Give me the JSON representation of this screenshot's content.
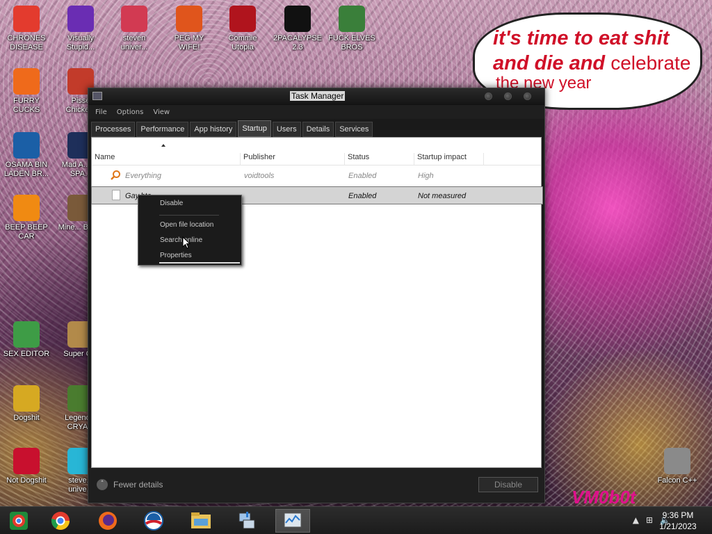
{
  "desktop": {
    "speech_bubble": {
      "line1": "it's time to eat shit",
      "line2_bold": "and die and",
      "line2_rest": "celebrate",
      "line3": "the new year"
    },
    "watermark": "VM0b0t",
    "icons": [
      {
        "label": "CHRONES DISEASE",
        "icon": "chrome-icon",
        "color": "#e33b2e"
      },
      {
        "label": "Visually Stupid...",
        "icon": "visual-studio-icon",
        "color": "#6a2db3"
      },
      {
        "label": "steven univer...",
        "icon": "steven-universe-icon",
        "color": "#d23a52"
      },
      {
        "label": "PEG MY WIFE!",
        "icon": "pizza-icon",
        "color": "#e0551c"
      },
      {
        "label": "Commie Utopia",
        "icon": "commie-icon",
        "color": "#b0141d"
      },
      {
        "label": "2PACALYPSE 2.3",
        "icon": "terminal-icon",
        "color": "#111111"
      },
      {
        "label": "FUCK ELVES BROS",
        "icon": "elf-icon",
        "color": "#3a7f3a"
      },
      {
        "label": "FURRY CUCKS",
        "icon": "firefox-icon",
        "color": "#ef6a1b"
      },
      {
        "label": "Pisse Chicke...",
        "icon": "angry-birds-icon",
        "color": "#c23b2a"
      },
      {
        "label": "OSAMA BIN LADEN BR...",
        "icon": "obama-icon",
        "color": "#1b5fa6"
      },
      {
        "label": "Mad A... IN SPA...",
        "icon": "angry-birds-space-icon",
        "color": "#1e2f5a"
      },
      {
        "label": "BEEP BEEP CAR",
        "icon": "vlc-icon",
        "color": "#f08a12"
      },
      {
        "label": "Mine... Bird...",
        "icon": "minecraft-bird-icon",
        "color": "#7a5a3a"
      },
      {
        "label": "SEX EDITOR",
        "icon": "hxd-icon",
        "color": "#3e9c46"
      },
      {
        "label": "Super C...",
        "icon": "super-c-icon",
        "color": "#b28a4a"
      },
      {
        "label": "Dogshit",
        "icon": "dog-icon",
        "color": "#d6a922"
      },
      {
        "label": "Legend... CRYA...",
        "icon": "legend-icon",
        "color": "#4a7c2f"
      },
      {
        "label": "Not Dogshit",
        "icon": "devcpp-icon",
        "color": "#c8102e"
      },
      {
        "label": "steve... unive...",
        "icon": "diamond-icon",
        "color": "#28b6d6"
      },
      {
        "label": "Falcon C++",
        "icon": "recycle-bin-icon",
        "color": "#8a8a8a"
      }
    ]
  },
  "task_manager": {
    "title": "Task Manager",
    "menu": [
      "File",
      "Options",
      "View"
    ],
    "tabs": [
      {
        "label": "Processes",
        "active": false
      },
      {
        "label": "Performance",
        "active": false
      },
      {
        "label": "App history",
        "active": false
      },
      {
        "label": "Startup",
        "active": true
      },
      {
        "label": "Users",
        "active": false
      },
      {
        "label": "Details",
        "active": false
      },
      {
        "label": "Services",
        "active": false
      }
    ],
    "columns": [
      "Name",
      "Publisher",
      "Status",
      "Startup impact"
    ],
    "rows": [
      {
        "name": "Everything",
        "publisher": "voidtools",
        "status": "Enabled",
        "impact": "High",
        "icon": "search-magnifier-icon",
        "selected": false
      },
      {
        "name": "Gay.bta",
        "publisher": "",
        "status": "Enabled",
        "impact": "Not measured",
        "icon": "file-icon",
        "selected": true
      }
    ],
    "footer": {
      "fewer_details": "Fewer details",
      "disable": "Disable"
    }
  },
  "context_menu": {
    "items": [
      "Disable",
      "Open file location",
      "Search online",
      "Properties"
    ]
  },
  "taskbar": {
    "time": "9:36 PM",
    "date": "1/21/2023",
    "pinned": [
      "start-icon",
      "chrome-icon",
      "firefox-icon",
      "obama-icon",
      "file-explorer-icon",
      "network-tool-icon",
      "task-manager-icon"
    ]
  }
}
